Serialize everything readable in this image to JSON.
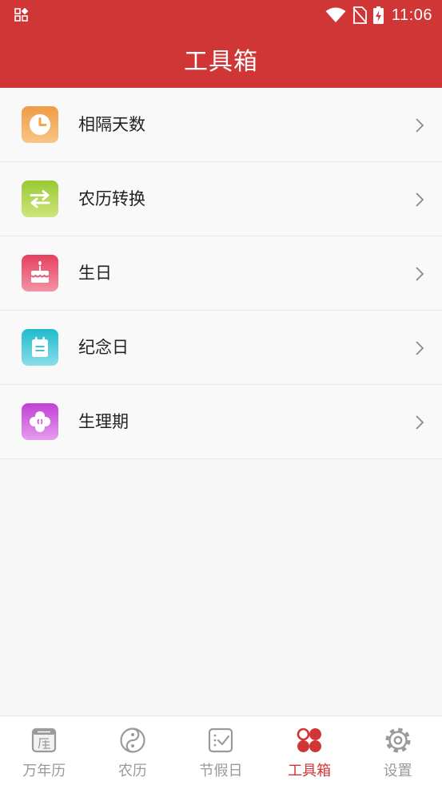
{
  "status_bar": {
    "time": "11:06",
    "icons": [
      "app-notification-icon",
      "wifi-icon",
      "no-sim-icon",
      "battery-charging-icon"
    ]
  },
  "header": {
    "title": "工具箱"
  },
  "tools": [
    {
      "label": "相隔天数",
      "icon": "clock-icon",
      "colors": [
        "#ef9b45",
        "#f7c685"
      ]
    },
    {
      "label": "农历转换",
      "icon": "swap-arrows-icon",
      "colors": [
        "#98c934",
        "#cfe57c"
      ]
    },
    {
      "label": "生日",
      "icon": "birthday-cake-icon",
      "colors": [
        "#e5405f",
        "#f492a6"
      ]
    },
    {
      "label": "纪念日",
      "icon": "notepad-icon",
      "colors": [
        "#20bbcc",
        "#8adee8"
      ]
    },
    {
      "label": "生理期",
      "icon": "flower-icon",
      "colors": [
        "#c13fd5",
        "#e69cee"
      ]
    }
  ],
  "bottom_nav": {
    "active": "工具箱",
    "items": [
      {
        "label": "万年历",
        "icon": "calendar-icon"
      },
      {
        "label": "农历",
        "icon": "yin-yang-icon"
      },
      {
        "label": "节假日",
        "icon": "holiday-checklist-icon"
      },
      {
        "label": "工具箱",
        "icon": "toolbox-grid-icon"
      },
      {
        "label": "设置",
        "icon": "gear-icon"
      }
    ]
  },
  "colors": {
    "primary": "#d13636",
    "inactive": "#9a9a9a",
    "background": "#f7f7f7"
  }
}
